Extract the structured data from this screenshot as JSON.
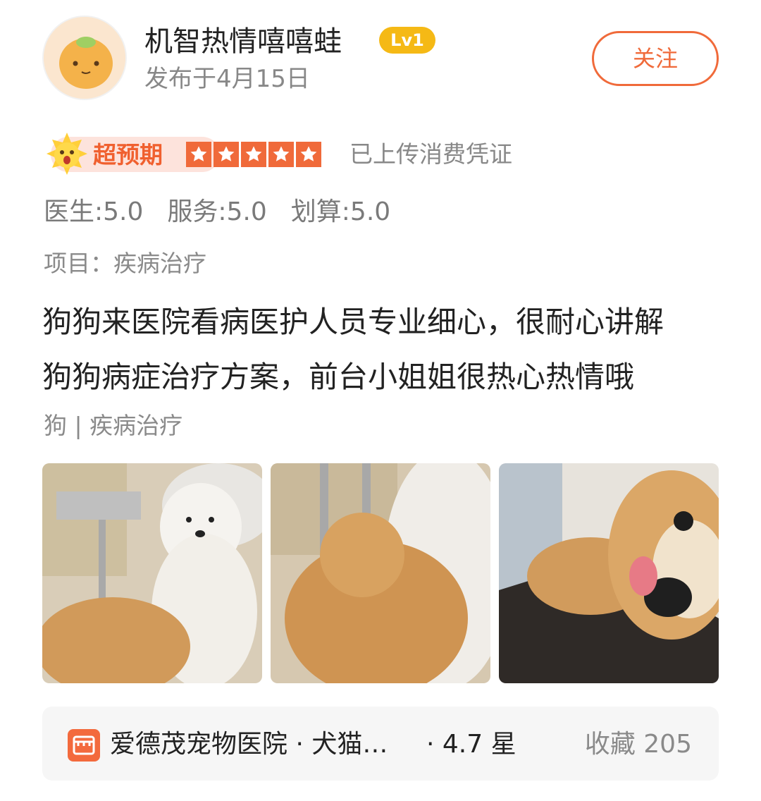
{
  "header": {
    "username": "机智热情嘻嘻蛙",
    "level": "Lv1",
    "post_date": "发布于4月15日",
    "follow_label": "关注"
  },
  "rating": {
    "expectation_label": "超预期",
    "stars": 5,
    "voucher_text": "已上传消费凭证",
    "star_color": "#f06a3a"
  },
  "scores": {
    "doctor": "医生:5.0",
    "service": "服务:5.0",
    "value": "划算:5.0"
  },
  "project": "项目：疾病治疗",
  "review": {
    "line1": "狗狗来医院看病医护人员专业细心，很耐心讲解",
    "line2": "狗狗病症治疗方案，前台小姐姐很热心热情哦"
  },
  "tags": "狗 | 疾病治疗",
  "photos": [
    "dog-photo-1",
    "dog-photo-2",
    "dog-photo-3"
  ],
  "shop": {
    "name": "爱德茂宠物医院 · 犬猫…",
    "rating": "· 4.7 星",
    "favorites": "收藏 205"
  },
  "colors": {
    "accent": "#f06a3a",
    "level_badge": "#f5b915",
    "muted_text": "#888888"
  }
}
